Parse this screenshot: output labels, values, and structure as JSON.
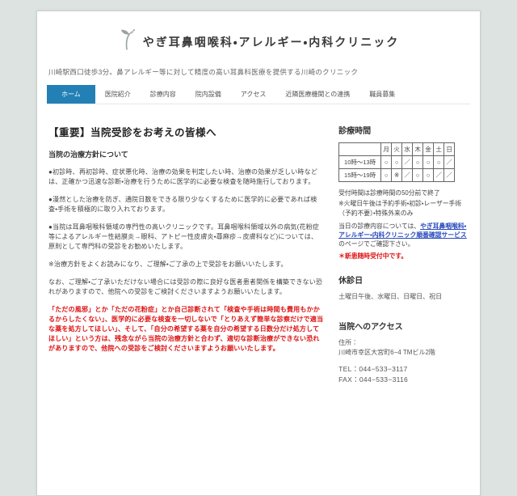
{
  "page": {
    "title": "やぎ耳鼻咽喉科・アレルギー・内科クリニック",
    "tagline": "川崎駅西口徒歩3分。鼻アレルギー等に対して精度の高い耳鼻科医療を提供する川崎のクリニック"
  },
  "nav": {
    "items": [
      {
        "label": "ホーム",
        "active": true
      },
      {
        "label": "医院紹介",
        "active": false
      },
      {
        "label": "診療内容",
        "active": false
      },
      {
        "label": "院内設備",
        "active": false
      },
      {
        "label": "アクセス",
        "active": false
      },
      {
        "label": "近隣医療機関との連携",
        "active": false
      },
      {
        "label": "職員募集",
        "active": false
      }
    ]
  },
  "main": {
    "heading": "【重要】当院受診をお考えの皆様へ",
    "subheading": "当院の治療方針について",
    "paragraphs": [
      "●初診時、再初診時、症状悪化時、治療の効果を判定したい時、治療の効果が乏しい時などは、正確かつ迅速な診断・治療を行うために医学的に必要な検査を随時施行しております。",
      "●漫然とした治療を防ぎ、通院日数をできる限り少なくするために医学的に必要であれば検査・手術を積極的に取り入れております。",
      "●当院は耳鼻咽喉科領域の専門性の高いクリニックです。耳鼻咽喉科領域以外の病気(花粉症等によるアレルギー性結膜炎→眼科、アトピー性皮膚炎・蕁麻疹→皮膚科など)については、原則として専門科の受診をお勧めいたします。",
      "※治療方針をよくお読みになり、ご理解・ご了承の上で受診をお願いいたします。",
      "なお、ご理解・ご了承いただけない場合には受診の際に良好な医者患者関係を構築できない恐れがありますので、他院への受診をご検討くださいますようお願いいたします。"
    ],
    "warning": "「ただの風邪」とか「ただの花粉症」とか自己診断されて「検査や手術は時間も費用もかかるからしたくない」、医学的に必要な検査を一切しないで「とりあえず簡単な診察だけで適当な薬を処方してほしい」、そして、「自分の希望する薬を自分の希望する日数分だけ処方してほしい」という方は、残念ながら当院の治療方針と合わず、適切な診断治療ができない恐れがありますので、他院への受診をご検討くださいますようお願いいたします。"
  },
  "sidebar": {
    "hours": {
      "heading": "診療時間",
      "table": {
        "day_headers": [
          "月",
          "火",
          "水",
          "木",
          "金",
          "土",
          "日"
        ],
        "rows": [
          {
            "label": "10時～13時",
            "cells": [
              "○",
              "○",
              "／",
              "○",
              "○",
              "○",
              "／"
            ]
          },
          {
            "label": "15時～19時",
            "cells": [
              "○",
              "※",
              "／",
              "○",
              "○",
              "／",
              "／"
            ]
          }
        ]
      },
      "note1": "受付時間は診療時間の50分前で終了",
      "note2": "※火曜日午後は予約手術・初診・レーザー手術（予約不要）・特殊外来のみ",
      "link_prefix": "当日の診療内容については、",
      "link_text": "やぎ耳鼻咽喉科・アレルギー・内科クリニック順番確認サービス",
      "link_suffix": "のページでご確認下さい。",
      "red_note": "＊新患随時受付中です。"
    },
    "closed": {
      "heading": "休診日",
      "days": "土曜日午後、水曜日、日曜日、祝日"
    },
    "access": {
      "heading": "当院へのアクセス",
      "address_label": "住所：",
      "address": "川崎市幸区大宮町6−4 TMビル2階",
      "tel": "TEL：044−533−3117",
      "fax": "FAX：044−533−3116"
    }
  },
  "colors": {
    "accent_blue": "#2380b5",
    "link_blue": "#2a4bbd",
    "warning_red": "#dd1414",
    "page_background": "#dce3e0"
  }
}
